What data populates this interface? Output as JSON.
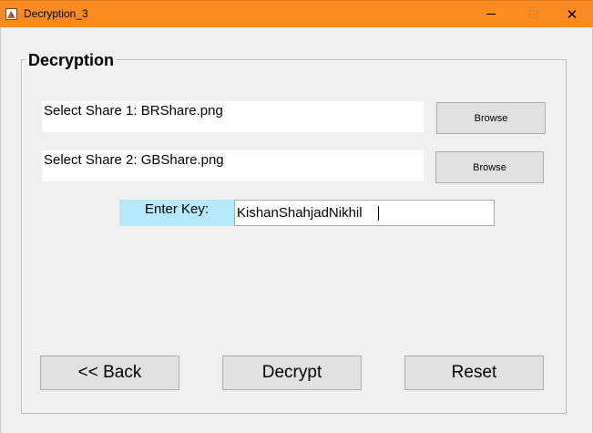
{
  "window": {
    "title": "Decryption_3",
    "accent_color": "#fb8c24",
    "app_icon": "app-icon",
    "controls": {
      "minimize_icon": "minimize-icon",
      "maximize_icon": "maximize-icon",
      "close_icon": "close-icon",
      "close_glyph": "✕"
    }
  },
  "panel": {
    "title": "Decryption"
  },
  "share1": {
    "text": "Select Share 1: BRShare.png",
    "browse_label": "Browse"
  },
  "share2": {
    "text": "Select Share 2: GBShare.png",
    "browse_label": "Browse"
  },
  "key": {
    "label": "Enter Key:",
    "value": "KishanShahjadNikhil",
    "label_background": "#b6e9fb"
  },
  "actions": {
    "back_label": "<< Back",
    "decrypt_label": "Decrypt",
    "reset_label": "Reset"
  }
}
